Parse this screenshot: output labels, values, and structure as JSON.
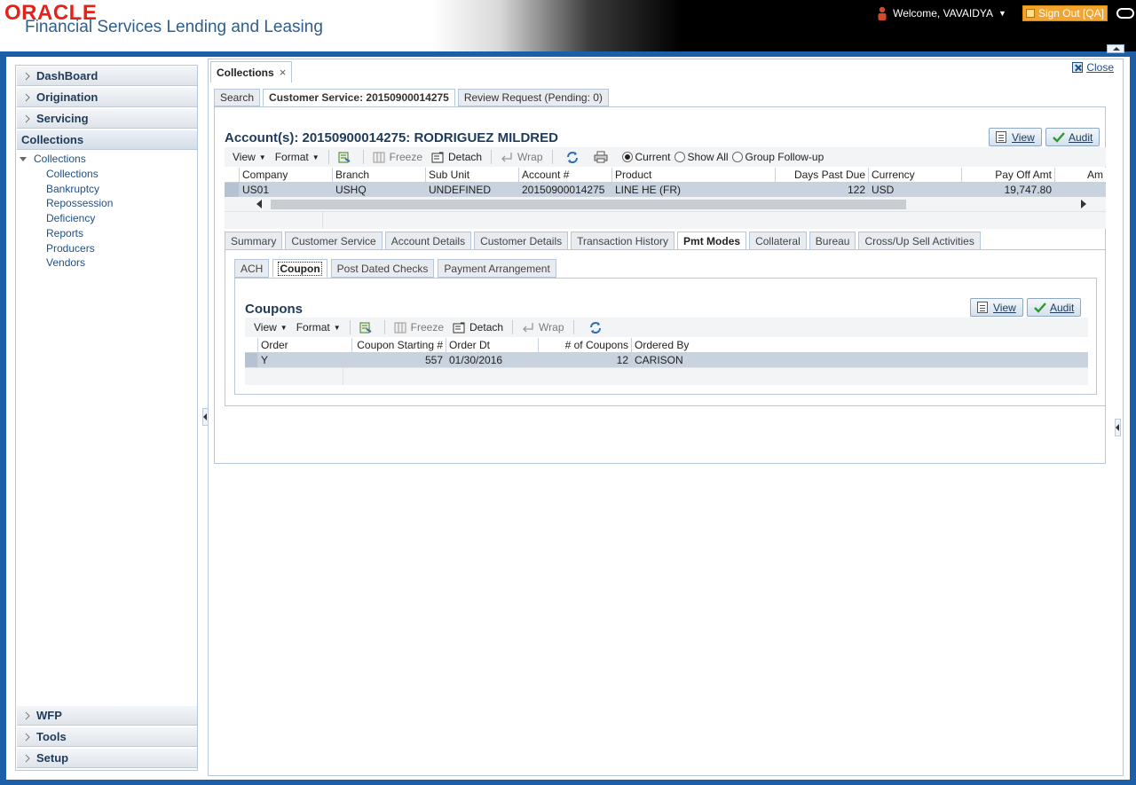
{
  "header": {
    "brand": "ORACLE",
    "product": "Financial Services Lending and Leasing",
    "welcome": "Welcome, VAVAIDYA",
    "signout": "Sign Out [QA]"
  },
  "sidebar": {
    "top_items": [
      "DashBoard",
      "Origination",
      "Servicing"
    ],
    "active_section": "Collections",
    "tree_root": "Collections",
    "tree_items": [
      "Collections",
      "Bankruptcy",
      "Repossession",
      "Deficiency",
      "Reports",
      "Producers",
      "Vendors"
    ],
    "bottom_items": [
      "WFP",
      "Tools",
      "Setup"
    ]
  },
  "main": {
    "tab": "Collections",
    "close": "Close",
    "subtabs": [
      "Search",
      "Customer Service: 20150900014275",
      "Review Request (Pending: 0)"
    ],
    "account_title": "Account(s): 20150900014275: RODRIGUEZ MILDRED",
    "view_btn": "View",
    "audit_btn": "Audit",
    "toolbar": {
      "view": "View",
      "format": "Format",
      "freeze": "Freeze",
      "detach": "Detach",
      "wrap": "Wrap",
      "radio_current": "Current",
      "radio_showall": "Show All",
      "radio_group": "Group Follow-up"
    },
    "accounts_table": {
      "columns": [
        "Company",
        "Branch",
        "Sub Unit",
        "Account #",
        "Product",
        "Days Past Due",
        "Currency",
        "Pay Off Amt",
        "Am"
      ],
      "row": [
        "US01",
        "USHQ",
        "UNDEFINED",
        "20150900014275",
        "LINE HE (FR)",
        "122",
        "USD",
        "19,747.80",
        ""
      ]
    },
    "detail_tabs": [
      "Summary",
      "Customer Service",
      "Account Details",
      "Customer Details",
      "Transaction History",
      "Pmt Modes",
      "Collateral",
      "Bureau",
      "Cross/Up Sell Activities"
    ],
    "pmt_tabs": [
      "ACH",
      "Coupon",
      "Post Dated Checks",
      "Payment Arrangement"
    ],
    "coupons": {
      "title": "Coupons",
      "view_btn": "View",
      "audit_btn": "Audit",
      "toolbar": {
        "view": "View",
        "format": "Format",
        "freeze": "Freeze",
        "detach": "Detach",
        "wrap": "Wrap"
      },
      "columns": [
        "Order",
        "Coupon Starting #",
        "Order Dt",
        "# of Coupons",
        "Ordered By"
      ],
      "row": [
        "Y",
        "557",
        "01/30/2016",
        "12",
        "CARISON"
      ]
    }
  },
  "colors": {
    "frame": "#1d5ea8",
    "brand_red": "#e2231a",
    "signout": "#f2a431",
    "row_selected": "#c8d3df"
  }
}
